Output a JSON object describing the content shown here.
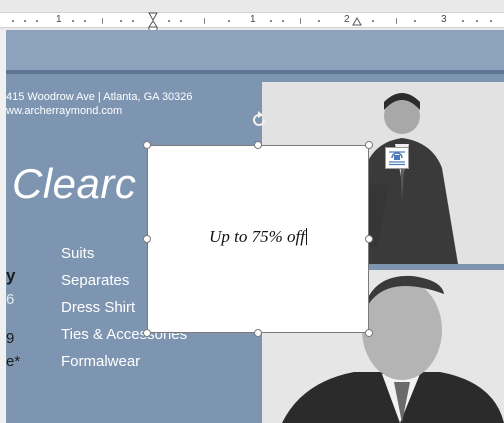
{
  "ruler": {
    "labels": [
      "1",
      "1",
      "2",
      "3"
    ]
  },
  "flyer": {
    "address_line1": "415 Woodrow Ave | Atlanta, GA 30326",
    "address_line2": "ww.archerraymond.com",
    "headline": "Clearc",
    "left_fragments": [
      "y",
      "6",
      "9",
      "e*"
    ],
    "menu_items": [
      "Suits",
      "Separates",
      "Dress Shirt",
      "Ties & Accessories",
      "Formalwear"
    ]
  },
  "textbox": {
    "text": "Up to 75% off"
  },
  "colors": {
    "flyer_background": "#7e95b2",
    "top_band": "#8ca2bd",
    "selection_border": "#7a7a7a"
  },
  "icons": {
    "rotate": "rotate-icon",
    "layout_options": "layout-options-icon",
    "first_line_indent": "indent-marker-icon",
    "tab_stop": "tab-stop-icon"
  }
}
